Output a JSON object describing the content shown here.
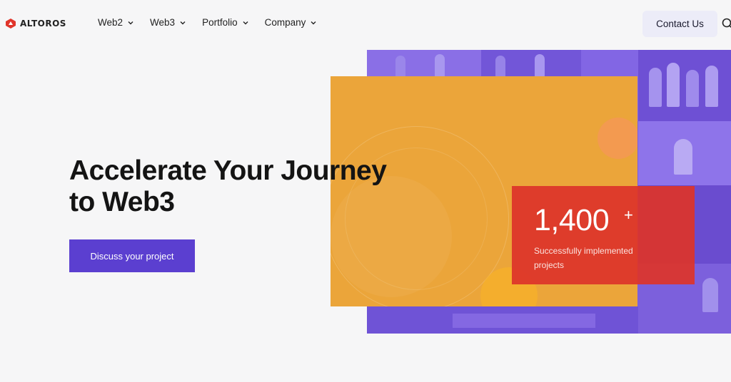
{
  "brand": {
    "name": "ALTOROS",
    "color": "#e0352b"
  },
  "nav": {
    "items": [
      {
        "label": "Web2"
      },
      {
        "label": "Web3"
      },
      {
        "label": "Portfolio"
      },
      {
        "label": "Company"
      }
    ],
    "contact_label": "Contact Us"
  },
  "hero": {
    "headline_line1": "Accelerate Your Journey",
    "headline_line2": "to Web3",
    "cta_label": "Discuss your project"
  },
  "stat": {
    "value": "1,400",
    "suffix": "+",
    "label": "Successfully implemented projects"
  },
  "colors": {
    "accent_purple": "#5b3fd0",
    "orange": "#eba53a",
    "red": "#dd342a",
    "photo_tint": "#7a5de0"
  }
}
